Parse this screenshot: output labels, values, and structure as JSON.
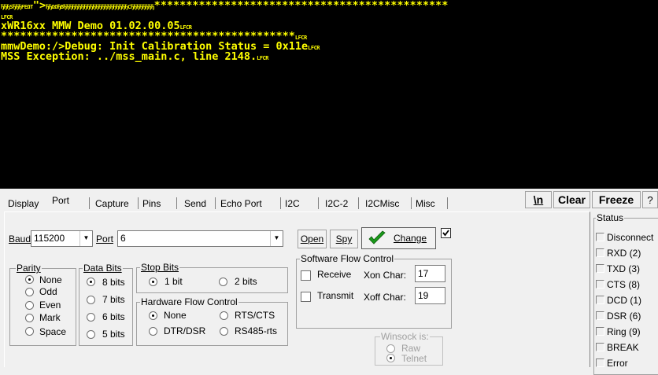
{
  "terminal": {
    "lines": [
      {
        "prefix_ctrl": "ЂЂЂSЂЂЂFEΩT",
        "prefix": "\">",
        "mid_ctrl": "ЂЂΩΩЂBЂЂЂЂЂЂЂЂЂЂЂЂЂЂЂЂЂЂЂЂЂЂCЂЂЂЂЂЂЂЂ",
        "tail": "**********************************************"
      },
      {
        "prefix_ctrl": "LFCR",
        "prefix": "",
        "mid_ctrl": "",
        "tail": ""
      },
      {
        "prefix_ctrl": "",
        "prefix": "xWR16xx MMW Demo 01.02.00.05",
        "mid_ctrl": "LFCR",
        "tail": ""
      },
      {
        "prefix_ctrl": "",
        "prefix": "**********************************************",
        "mid_ctrl": "LFCR",
        "tail": ""
      },
      {
        "prefix_ctrl": "",
        "prefix": "mmwDemo:/>Debug: Init Calibration Status = 0x11e",
        "mid_ctrl": "LFCR",
        "tail": ""
      },
      {
        "prefix_ctrl": "",
        "prefix": "MSS Exception: ../mss_main.c, line 2148.",
        "mid_ctrl": "LFCR",
        "tail": ""
      }
    ],
    "text_color": "#ffff00",
    "background": "#000000"
  },
  "tabs": [
    "Display",
    "Port",
    "Capture",
    "Pins",
    "Send",
    "Echo Port",
    "I2C",
    "I2C-2",
    "I2CMisc",
    "Misc"
  ],
  "active_tab": "Port",
  "toolbar": {
    "newline": "\\n",
    "clear": "Clear",
    "freeze": "Freeze",
    "help": "?"
  },
  "port": {
    "baud_label": "Baud",
    "baud_value": "115200",
    "port_label": "Port",
    "port_value": "6",
    "open": "Open",
    "spy": "Spy",
    "change": "Change",
    "change_checked": true
  },
  "parity": {
    "title": "Parity",
    "options": [
      "None",
      "Odd",
      "Even",
      "Mark",
      "Space"
    ],
    "selected": "None"
  },
  "data_bits": {
    "title": "Data Bits",
    "options": [
      "8 bits",
      "7 bits",
      "6 bits",
      "5 bits"
    ],
    "selected": "8 bits"
  },
  "stop_bits": {
    "title": "Stop Bits",
    "options": [
      "1 bit",
      "2 bits"
    ],
    "selected": "1 bit"
  },
  "hw_flow": {
    "title": "Hardware Flow Control",
    "options": [
      "None",
      "RTS/CTS",
      "DTR/DSR",
      "RS485-rts"
    ],
    "selected": "None"
  },
  "sw_flow": {
    "title": "Software Flow Control",
    "receive": "Receive",
    "transmit": "Transmit",
    "xon_label": "Xon Char:",
    "xon_value": "17",
    "xoff_label": "Xoff Char:",
    "xoff_value": "19"
  },
  "winsock": {
    "title": "Winsock is:",
    "options": [
      "Raw",
      "Telnet"
    ],
    "selected": "Telnet"
  },
  "status": {
    "title": "Status",
    "items": [
      "Disconnect",
      "RXD (2)",
      "TXD (3)",
      "CTS (8)",
      "DCD (1)",
      "DSR (6)",
      "Ring (9)",
      "BREAK",
      "Error"
    ]
  },
  "colors": {
    "terminal_text": "#ffff00",
    "change_check": "#1a9a1a"
  }
}
